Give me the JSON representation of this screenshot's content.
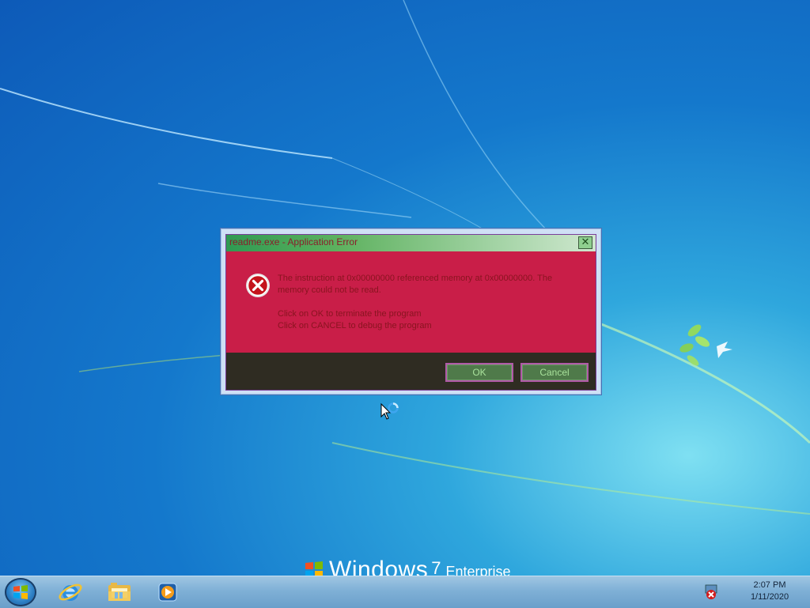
{
  "dialog": {
    "title": "readme.exe - Application Error",
    "close_glyph": "✕",
    "message_line1": "The instruction at 0x00000000 referenced memory at 0x00000000. The",
    "message_line2": "memory could not be read.",
    "message_line3": "Click on OK to terminate the program",
    "message_line4": "Click on CANCEL to debug the program",
    "ok_label": "OK",
    "cancel_label": "Cancel",
    "icon": "error-icon"
  },
  "branding": {
    "windows": "Windows",
    "version": "7",
    "edition": "Enterprise"
  },
  "taskbar": {
    "pinned": [
      "internet-explorer-icon",
      "windows-explorer-icon",
      "media-player-icon"
    ],
    "tray_icon": "network-error-icon",
    "time": "2:07 PM",
    "date": "1/11/2020"
  },
  "colors": {
    "dialog_body": "#c91e48",
    "dialog_footer": "#2f2c22",
    "button_fill": "#4f7a4a",
    "button_text": "#a8e19b"
  }
}
